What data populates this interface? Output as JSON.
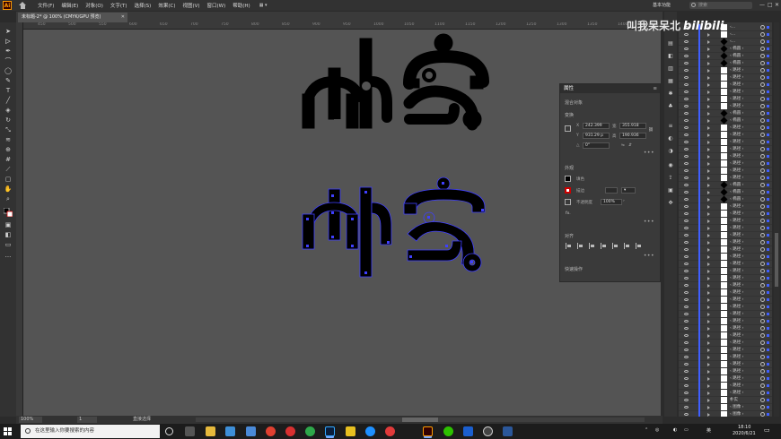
{
  "menubar": {
    "logo": "Ai",
    "items": [
      "文件(F)",
      "编辑(E)",
      "对象(O)",
      "文字(T)",
      "选择(S)",
      "效果(C)",
      "视图(V)",
      "窗口(W)",
      "帮助(H)"
    ],
    "layout_icon": "layout-grid-icon",
    "workspace": "基本功能",
    "search_placeholder": "搜索",
    "window_controls": [
      "—",
      "□",
      "✕"
    ]
  },
  "document_tab": {
    "title": "未标题-2* @ 100% (CMYK/GPU 预览)",
    "close": "✕"
  },
  "ruler_labels": [
    "450",
    "500",
    "550",
    "600",
    "650",
    "700",
    "750",
    "800",
    "850",
    "900",
    "950",
    "1000",
    "1050",
    "1100",
    "1150",
    "1200",
    "1250",
    "1300",
    "1350",
    "1400",
    "1450"
  ],
  "canvas": {
    "artwork_top": "朴实 (filled)",
    "artwork_bottom": "朴实 (selected outline)"
  },
  "watermark": {
    "author": "叫我呆呆北",
    "brand": "bilibili"
  },
  "properties": {
    "title": "属性",
    "subtitle": "混合对象",
    "section_transform": "变换",
    "x_label": "X",
    "x_value": "242.399",
    "y_label": "Y",
    "y_value": "931.29 p",
    "w_label": "宽",
    "w_value": "355.918",
    "h_label": "高",
    "h_value": "190.936",
    "angle_label": "△",
    "angle_value": "0°",
    "section_appearance": "外观",
    "fill_label": "填色",
    "stroke_label": "描边",
    "opacity_label": "不透明度",
    "opacity_value": "100%",
    "fx_label": "fx.",
    "section_align": "对齐",
    "section_quick_actions": "快速操作",
    "more": "•••"
  },
  "statusbar": {
    "zoom": "100%",
    "page": "1",
    "tool": "直接选择"
  },
  "layers": {
    "rows": [
      {
        "name": "‹...",
        "thumb": "white"
      },
      {
        "name": "‹...",
        "thumb": "white"
      },
      {
        "name": "‹...",
        "thumb": "diamond"
      },
      {
        "name": "‹ 椭圆 ›",
        "thumb": "diamond"
      },
      {
        "name": "‹ 椭圆 ›",
        "thumb": "diamond"
      },
      {
        "name": "‹ 椭圆 ›",
        "thumb": "diamond"
      },
      {
        "name": "‹ 路径 ›",
        "thumb": "white"
      },
      {
        "name": "‹ 路径 ›",
        "thumb": "white"
      },
      {
        "name": "‹ 路径 ›",
        "thumb": "white"
      },
      {
        "name": "‹ 路径 ›",
        "thumb": "white"
      },
      {
        "name": "‹ 路径 ›",
        "thumb": "white"
      },
      {
        "name": "‹ 路径 ›",
        "thumb": "white"
      },
      {
        "name": "‹ 椭圆 ›",
        "thumb": "diamond"
      },
      {
        "name": "‹ 椭圆 ›",
        "thumb": "diamond"
      },
      {
        "name": "‹ 路径 ›",
        "thumb": "white"
      },
      {
        "name": "‹ 路径 ›",
        "thumb": "white"
      },
      {
        "name": "‹ 路径 ›",
        "thumb": "white"
      },
      {
        "name": "‹ 路径 ›",
        "thumb": "white"
      },
      {
        "name": "‹ 路径 ›",
        "thumb": "white"
      },
      {
        "name": "‹ 路径 ›",
        "thumb": "white"
      },
      {
        "name": "‹ 路径 ›",
        "thumb": "white"
      },
      {
        "name": "‹ 路径 ›",
        "thumb": "white"
      },
      {
        "name": "‹ 椭圆 ›",
        "thumb": "diamond"
      },
      {
        "name": "‹ 椭圆 ›",
        "thumb": "diamond"
      },
      {
        "name": "‹ 椭圆 ›",
        "thumb": "diamond"
      },
      {
        "name": "‹ 路径 ›",
        "thumb": "white"
      },
      {
        "name": "‹ 路径 ›",
        "thumb": "white"
      },
      {
        "name": "‹ 路径 ›",
        "thumb": "white"
      },
      {
        "name": "‹ 路径 ›",
        "thumb": "white"
      },
      {
        "name": "‹ 路径 ›",
        "thumb": "white"
      },
      {
        "name": "‹ 路径 ›",
        "thumb": "white"
      },
      {
        "name": "‹ 路径 ›",
        "thumb": "white"
      },
      {
        "name": "‹ 路径 ›",
        "thumb": "white"
      },
      {
        "name": "‹ 路径 ›",
        "thumb": "white"
      },
      {
        "name": "‹ 路径 ›",
        "thumb": "white"
      },
      {
        "name": "‹ 路径 ›",
        "thumb": "white"
      },
      {
        "name": "‹ 路径 ›",
        "thumb": "white"
      },
      {
        "name": "‹ 路径 ›",
        "thumb": "white"
      },
      {
        "name": "‹ 路径 ›",
        "thumb": "white"
      },
      {
        "name": "‹ 路径 ›",
        "thumb": "white"
      },
      {
        "name": "‹ 路径 ›",
        "thumb": "white"
      },
      {
        "name": "‹ 路径 ›",
        "thumb": "white"
      },
      {
        "name": "‹ 路径 ›",
        "thumb": "white"
      },
      {
        "name": "‹ 路径 ›",
        "thumb": "white"
      },
      {
        "name": "‹ 路径 ›",
        "thumb": "white"
      },
      {
        "name": "‹ 路径 ›",
        "thumb": "white"
      },
      {
        "name": "‹ 路径 ›",
        "thumb": "white"
      },
      {
        "name": "‹ 路径 ›",
        "thumb": "white"
      },
      {
        "name": "‹ 路径 ›",
        "thumb": "white"
      },
      {
        "name": "‹ 路径 ›",
        "thumb": "white"
      },
      {
        "name": "‹ 路径 ›",
        "thumb": "white"
      },
      {
        "name": "‹ 路径 ›",
        "thumb": "white"
      },
      {
        "name": "朴实",
        "thumb": "white"
      },
      {
        "name": "‹ 图像 ›",
        "thumb": "white"
      },
      {
        "name": "‹ 图像 ›",
        "thumb": "white"
      }
    ]
  },
  "taskbar": {
    "search_placeholder": "在这里输入你要搜索的内容",
    "time": "18:10",
    "date": "2020/6/21",
    "lang": "英",
    "apps": [
      "task-view",
      "wechat-work",
      "file-explorer",
      "calculator",
      "chrome",
      "netease-music",
      "360",
      "photoshop",
      "note",
      "tencent-video",
      "app-red",
      "illustrator",
      "wechat",
      "mail",
      "media-player",
      "word"
    ],
    "accent": "#ff9a00"
  }
}
